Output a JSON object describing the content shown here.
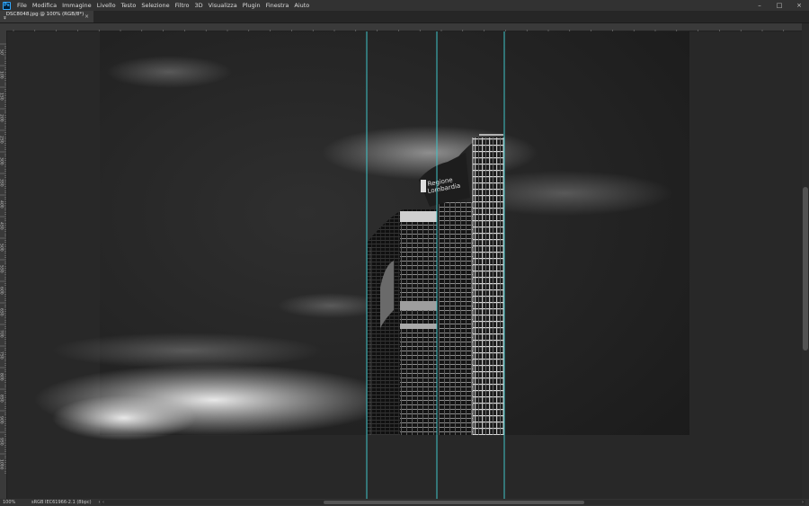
{
  "app": {
    "logo_text": "Ps"
  },
  "menu": {
    "items": [
      "File",
      "Modifica",
      "Immagine",
      "Livello",
      "Testo",
      "Selezione",
      "Filtro",
      "3D",
      "Visualizza",
      "Plugin",
      "Finestra",
      "Aiuto"
    ]
  },
  "window_controls": {
    "minimize": "–",
    "maximize": "□",
    "close": "×"
  },
  "document_tab": {
    "title": "_DSC8048.jpg @ 100% (RGB/8*) *",
    "close": "×"
  },
  "ruler": {
    "horizontal_labels": [
      "250",
      "200",
      "150",
      "100",
      "50",
      "0",
      "50",
      "100",
      "150",
      "200",
      "250",
      "300",
      "350",
      "400",
      "450",
      "500",
      "550",
      "600",
      "650",
      "700",
      "750",
      "800",
      "850",
      "900",
      "950",
      "1000",
      "1050",
      "1100",
      "1150",
      "1200",
      "1250",
      "1300",
      "1350",
      "1400",
      "1450",
      "1500",
      "1550",
      "1600",
      "16"
    ],
    "vertical_labels": [
      "50",
      "100",
      "150",
      "200",
      "250",
      "300",
      "350",
      "400",
      "450",
      "500",
      "550",
      "600",
      "650",
      "700",
      "750",
      "800",
      "850",
      "900",
      "950",
      "1000"
    ]
  },
  "image": {
    "subject": "black and white skyscraper long exposure",
    "building_sign": "Regione Lombardia"
  },
  "guides": {
    "color": "#3fc4c8"
  },
  "status": {
    "zoom": "100%",
    "profile": "sRGB IEC61966-2.1 (8bpc)",
    "arrow": "›"
  },
  "scrollbars": {
    "left_arrow": "‹",
    "right_arrow": "›"
  }
}
